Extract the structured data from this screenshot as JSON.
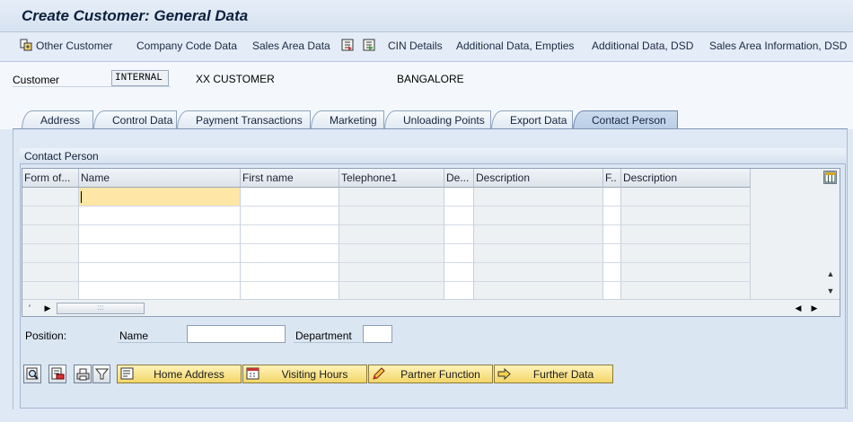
{
  "window": {
    "title": "Create Customer: General Data"
  },
  "toolbar": {
    "items": [
      {
        "label": "Other Customer",
        "icon": "other-customer-icon"
      },
      {
        "label": "Company Code Data"
      },
      {
        "label": "Sales Area Data"
      },
      {
        "label": "CIN Details"
      },
      {
        "label": "Additional Data, Empties"
      },
      {
        "label": "Additional Data, DSD"
      },
      {
        "label": "Sales Area Information, DSD"
      }
    ]
  },
  "header": {
    "customer_label": "Customer",
    "customer_value": "INTERNAL",
    "customer_name": "XX CUSTOMER",
    "city": "BANGALORE"
  },
  "tabs": [
    {
      "label": "Address"
    },
    {
      "label": "Control Data"
    },
    {
      "label": "Payment Transactions"
    },
    {
      "label": "Marketing"
    },
    {
      "label": "Unloading Points"
    },
    {
      "label": "Export Data"
    },
    {
      "label": "Contact Person",
      "active": true
    }
  ],
  "contact_group": {
    "title": "Contact Person",
    "columns": [
      "Form of...",
      "Name",
      "First name",
      "Telephone1",
      "De...",
      "Description",
      "F..",
      "Description"
    ],
    "rows_visible": 6
  },
  "fields": {
    "position_label": "Position:",
    "name_label": "Name",
    "name_value": "",
    "department_label": "Department",
    "department_value": ""
  },
  "buttons": {
    "home_address": "Home Address",
    "visiting_hours": "Visiting Hours",
    "partner_function": "Partner Function",
    "further_data": "Further Data"
  },
  "colors": {
    "background": "#dfe9f5",
    "button_yellow": "#f3d66a",
    "selected_cell": "#fde6a6",
    "active_tab": "#b8cde6"
  }
}
